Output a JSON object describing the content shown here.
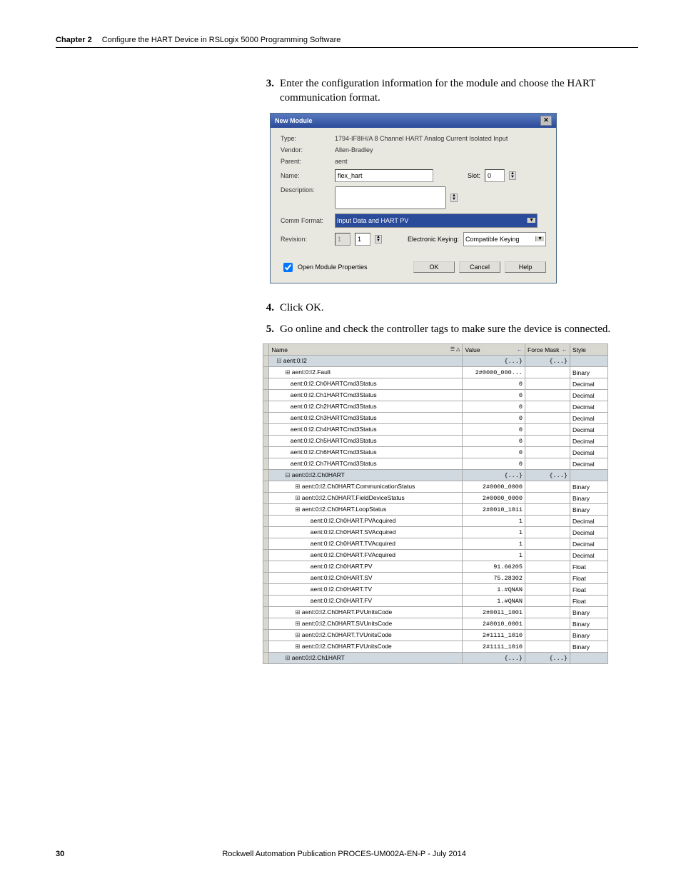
{
  "header": {
    "chapter": "Chapter 2",
    "title": "Configure the HART Device in RSLogix 5000 Programming Software"
  },
  "steps": {
    "s3": {
      "num": "3.",
      "text": "Enter the configuration information for the module and choose the HART communication format."
    },
    "s4": {
      "num": "4.",
      "text": "Click OK."
    },
    "s5": {
      "num": "5.",
      "text": "Go online and check the controller tags to make sure the device is connected."
    }
  },
  "dialog": {
    "title": "New Module",
    "type_label": "Type:",
    "type_val": "1794-IF8IH/A 8 Channel HART Analog Current Isolated Input",
    "vendor_label": "Vendor:",
    "vendor_val": "Allen-Bradley",
    "parent_label": "Parent:",
    "parent_val": "aent",
    "name_label": "Name:",
    "name_val": "flex_hart",
    "slot_label": "Slot:",
    "slot_val": "0",
    "desc_label": "Description:",
    "desc_val": "",
    "comm_label": "Comm Format:",
    "comm_val": "Input Data and HART PV",
    "rev_label": "Revision:",
    "rev_major": "1",
    "rev_minor": "1",
    "ek_label": "Electronic Keying:",
    "ek_val": "Compatible Keying",
    "open_props": "Open Module Properties",
    "ok": "OK",
    "cancel": "Cancel",
    "help": "Help"
  },
  "tagcols": {
    "name": "Name",
    "value": "Value",
    "force": "Force Mask",
    "style": "Style"
  },
  "tagrows": [
    {
      "depth": 1,
      "glyph": "⊟",
      "name": "aent:0:I2",
      "value": "{...}",
      "force": "{...}",
      "style": "",
      "hl": true
    },
    {
      "depth": 2,
      "glyph": "⊞",
      "name": "aent:0:I2.Fault",
      "value": "2#0000_000...",
      "force": "",
      "style": "Binary"
    },
    {
      "depth": 2,
      "glyph": " ",
      "name": "aent:0:I2.Ch0HARTCmd3Status",
      "value": "0",
      "force": "",
      "style": "Decimal"
    },
    {
      "depth": 2,
      "glyph": " ",
      "name": "aent:0:I2.Ch1HARTCmd3Status",
      "value": "0",
      "force": "",
      "style": "Decimal"
    },
    {
      "depth": 2,
      "glyph": " ",
      "name": "aent:0:I2.Ch2HARTCmd3Status",
      "value": "0",
      "force": "",
      "style": "Decimal"
    },
    {
      "depth": 2,
      "glyph": " ",
      "name": "aent:0:I2.Ch3HARTCmd3Status",
      "value": "0",
      "force": "",
      "style": "Decimal"
    },
    {
      "depth": 2,
      "glyph": " ",
      "name": "aent:0:I2.Ch4HARTCmd3Status",
      "value": "0",
      "force": "",
      "style": "Decimal"
    },
    {
      "depth": 2,
      "glyph": " ",
      "name": "aent:0:I2.Ch5HARTCmd3Status",
      "value": "0",
      "force": "",
      "style": "Decimal"
    },
    {
      "depth": 2,
      "glyph": " ",
      "name": "aent:0:I2.Ch6HARTCmd3Status",
      "value": "0",
      "force": "",
      "style": "Decimal"
    },
    {
      "depth": 2,
      "glyph": " ",
      "name": "aent:0:I2.Ch7HARTCmd3Status",
      "value": "0",
      "force": "",
      "style": "Decimal"
    },
    {
      "depth": 2,
      "glyph": "⊟",
      "name": "aent:0:I2.Ch0HART",
      "value": "{...}",
      "force": "{...}",
      "style": "",
      "hl": true
    },
    {
      "depth": 3,
      "glyph": "⊞",
      "name": "aent:0:I2.Ch0HART.CommunicationStatus",
      "value": "2#0000_0000",
      "force": "",
      "style": "Binary"
    },
    {
      "depth": 3,
      "glyph": "⊞",
      "name": "aent:0:I2.Ch0HART.FieldDeviceStatus",
      "value": "2#0000_0000",
      "force": "",
      "style": "Binary"
    },
    {
      "depth": 3,
      "glyph": "⊞",
      "name": "aent:0:I2.Ch0HART.LoopStatus",
      "value": "2#0010_1011",
      "force": "",
      "style": "Binary"
    },
    {
      "depth": 4,
      "glyph": " ",
      "name": "aent:0:I2.Ch0HART.PVAcquired",
      "value": "1",
      "force": "",
      "style": "Decimal"
    },
    {
      "depth": 4,
      "glyph": " ",
      "name": "aent:0:I2.Ch0HART.SVAcquired",
      "value": "1",
      "force": "",
      "style": "Decimal"
    },
    {
      "depth": 4,
      "glyph": " ",
      "name": "aent:0:I2.Ch0HART.TVAcquired",
      "value": "1",
      "force": "",
      "style": "Decimal"
    },
    {
      "depth": 4,
      "glyph": " ",
      "name": "aent:0:I2.Ch0HART.FVAcquired",
      "value": "1",
      "force": "",
      "style": "Decimal"
    },
    {
      "depth": 4,
      "glyph": " ",
      "name": "aent:0:I2.Ch0HART.PV",
      "value": "91.66205",
      "force": "",
      "style": "Float"
    },
    {
      "depth": 4,
      "glyph": " ",
      "name": "aent:0:I2.Ch0HART.SV",
      "value": "75.28302",
      "force": "",
      "style": "Float"
    },
    {
      "depth": 4,
      "glyph": " ",
      "name": "aent:0:I2.Ch0HART.TV",
      "value": "1.#QNAN",
      "force": "",
      "style": "Float"
    },
    {
      "depth": 4,
      "glyph": " ",
      "name": "aent:0:I2.Ch0HART.FV",
      "value": "1.#QNAN",
      "force": "",
      "style": "Float"
    },
    {
      "depth": 3,
      "glyph": "⊞",
      "name": "aent:0:I2.Ch0HART.PVUnitsCode",
      "value": "2#0011_1001",
      "force": "",
      "style": "Binary"
    },
    {
      "depth": 3,
      "glyph": "⊞",
      "name": "aent:0:I2.Ch0HART.SVUnitsCode",
      "value": "2#0010_0001",
      "force": "",
      "style": "Binary"
    },
    {
      "depth": 3,
      "glyph": "⊞",
      "name": "aent:0:I2.Ch0HART.TVUnitsCode",
      "value": "2#1111_1010",
      "force": "",
      "style": "Binary"
    },
    {
      "depth": 3,
      "glyph": "⊞",
      "name": "aent:0:I2.Ch0HART.FVUnitsCode",
      "value": "2#1111_1010",
      "force": "",
      "style": "Binary"
    },
    {
      "depth": 2,
      "glyph": "⊞",
      "name": "aent:0:I2.Ch1HART",
      "value": "{...}",
      "force": "{...}",
      "style": "",
      "hl": true
    }
  ],
  "footer": {
    "page": "30",
    "pub": "Rockwell Automation Publication PROCES-UM002A-EN-P - July 2014"
  }
}
